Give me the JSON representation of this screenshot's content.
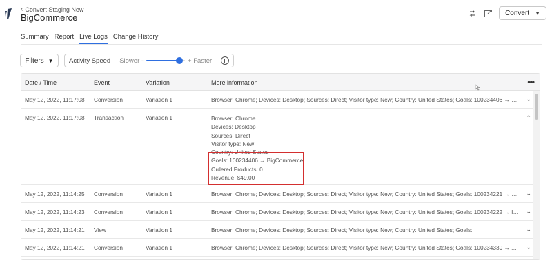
{
  "header": {
    "breadcrumb": "Convert Staging New",
    "title": "BigCommerce",
    "project_button": "Convert"
  },
  "tabs": [
    {
      "label": "Summary",
      "active": false
    },
    {
      "label": "Report",
      "active": false
    },
    {
      "label": "Live Logs",
      "active": true
    },
    {
      "label": "Change History",
      "active": false
    }
  ],
  "toolbar": {
    "filters_label": "Filters",
    "activity_speed_label": "Activity Speed",
    "slower_label": "Slower -",
    "faster_label": "+ Faster",
    "speed_level": 0.85
  },
  "table": {
    "columns": [
      "Date / Time",
      "Event",
      "Variation",
      "More information"
    ],
    "rows": [
      {
        "date": "May 12, 2022, 11:17:08",
        "event": "Conversion",
        "variation": "Variation 1",
        "info": "Browser: Chrome; Devices: Desktop; Sources: Direct; Visitor type: New; Country: United States; Goals: 100234406 → BigCo..."
      },
      {
        "date": "May 12, 2022, 11:17:08",
        "event": "Transaction",
        "variation": "Variation 1",
        "expanded": true,
        "details": [
          "Browser: Chrome",
          "Devices: Desktop",
          "Sources: Direct",
          "Visitor type: New",
          "Country: United States",
          "Goals: 100234406 → BigCommerce",
          "Ordered Products: 0",
          "Revenue: $49.00"
        ]
      },
      {
        "date": "May 12, 2022, 11:14:25",
        "event": "Conversion",
        "variation": "Variation 1",
        "info": "Browser: Chrome; Devices: Desktop; Sources: Direct; Visitor type: New; Country: United States; Goals: 100234221 → Decrea..."
      },
      {
        "date": "May 12, 2022, 11:14:23",
        "event": "Conversion",
        "variation": "Variation 1",
        "info": "Browser: Chrome; Devices: Desktop; Sources: Direct; Visitor type: New; Country: United States; Goals: 100234222 → Increas..."
      },
      {
        "date": "May 12, 2022, 11:14:21",
        "event": "View",
        "variation": "Variation 1",
        "info": "Browser: Chrome; Devices: Desktop; Sources: Direct; Visitor type: New; Country: United States; Goals:"
      },
      {
        "date": "May 12, 2022, 11:14:21",
        "event": "Conversion",
        "variation": "Variation 1",
        "info": "Browser: Chrome; Devices: Desktop; Sources: Direct; Visitor type: New; Country: United States; Goals: 100234339 → Advanc..."
      }
    ]
  },
  "colors": {
    "accent": "#2f6fe0",
    "highlight_border": "#d32f2f"
  }
}
